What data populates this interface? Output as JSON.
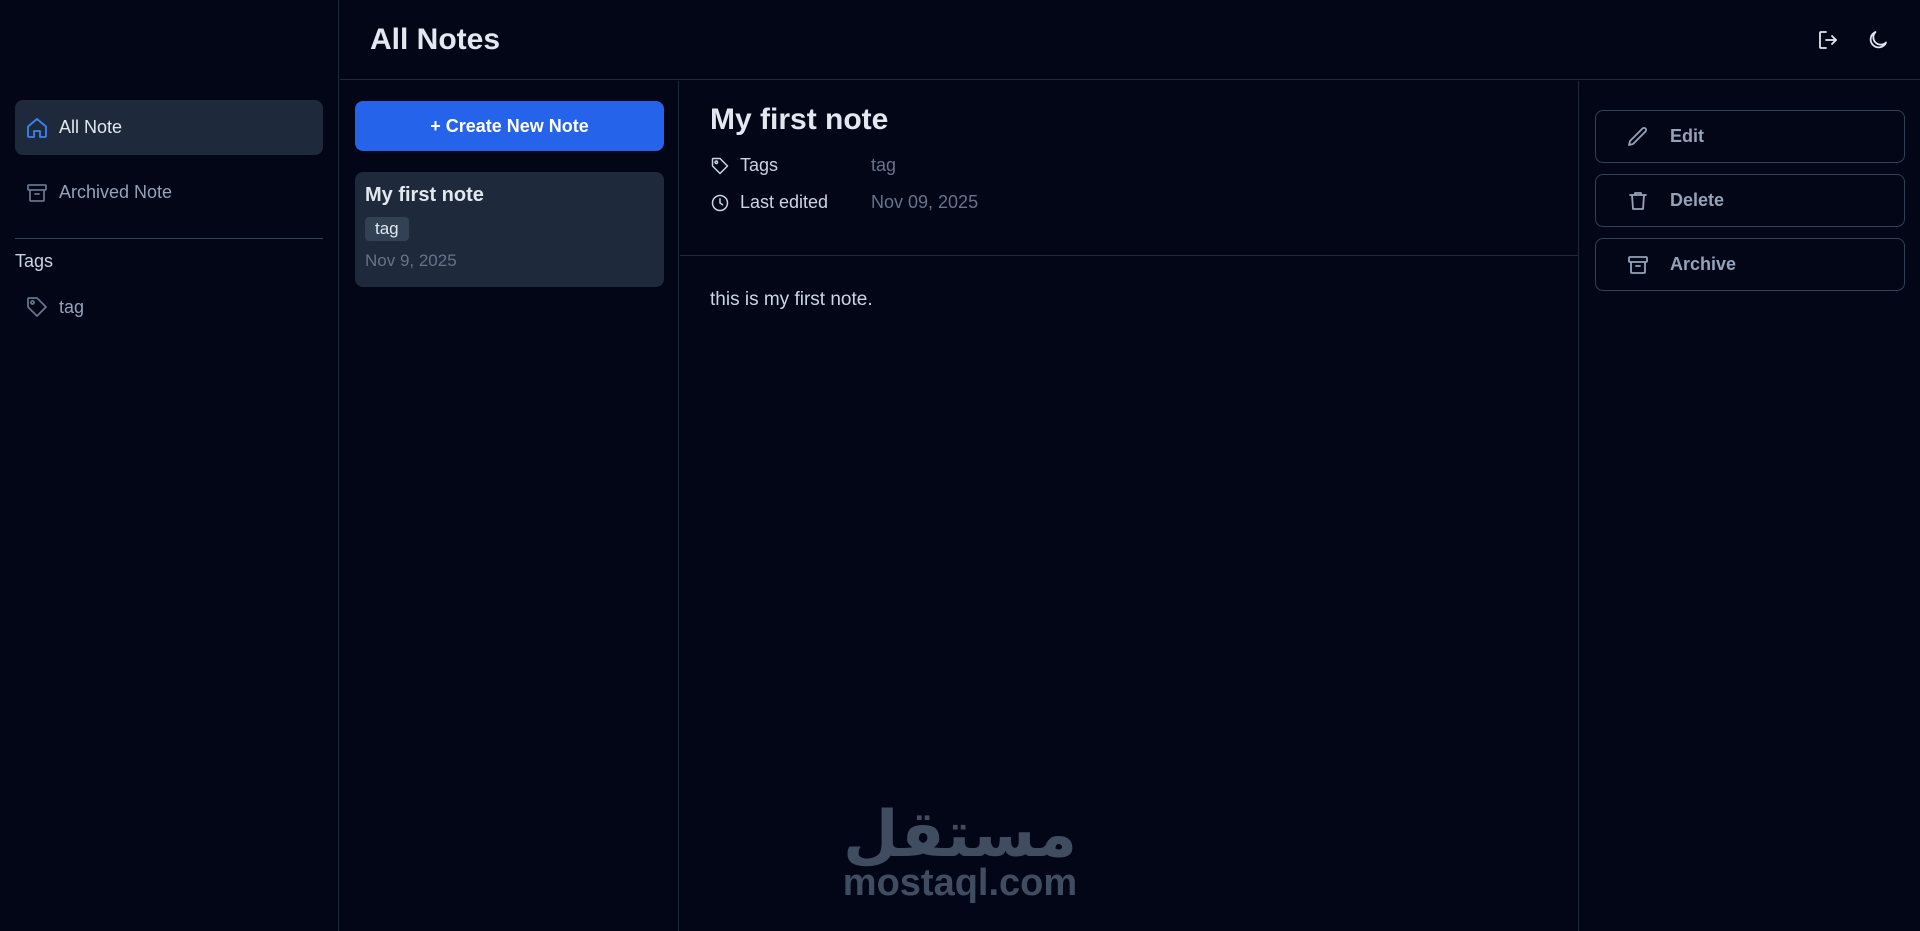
{
  "header": {
    "title": "All Notes",
    "logout_icon": "logout-icon",
    "theme_icon": "moon-icon"
  },
  "sidebar": {
    "items": [
      {
        "label": "All Note",
        "icon": "home-icon",
        "active": true
      },
      {
        "label": "Archived Note",
        "icon": "archive-icon",
        "active": false
      }
    ],
    "tags_heading": "Tags",
    "tags": [
      {
        "label": "tag",
        "icon": "tag-icon"
      }
    ]
  },
  "notes_list": {
    "create_label": "+ Create New Note",
    "notes": [
      {
        "title": "My first note",
        "tag": "tag",
        "date": "Nov 9, 2025"
      }
    ]
  },
  "detail": {
    "title": "My first note",
    "tags_label": "Tags",
    "tags_value": "tag",
    "edited_label": "Last edited",
    "edited_value": "Nov 09, 2025",
    "body": "this is my first note."
  },
  "actions": {
    "edit": "Edit",
    "delete": "Delete",
    "archive": "Archive"
  },
  "watermark": {
    "arabic": "مستقل",
    "latin": "mostaql.com"
  },
  "colors": {
    "background": "#020617",
    "accent": "#2563eb",
    "card": "#1e293b",
    "muted": "#64748b"
  }
}
